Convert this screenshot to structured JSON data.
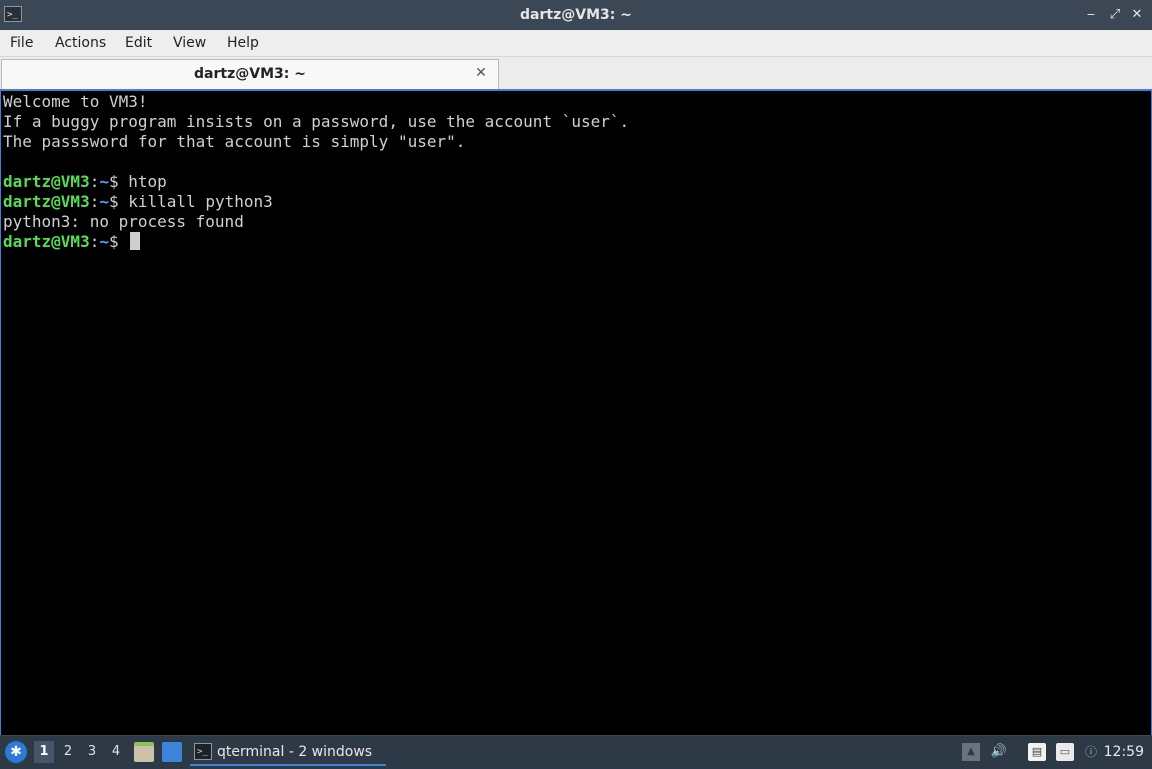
{
  "window": {
    "title": "dartz@VM3: ~",
    "app_icon": "terminal-icon",
    "buttons": {
      "minimize": "‒",
      "restore": "⤢",
      "close": "✕"
    }
  },
  "menubar": {
    "items": [
      "File",
      "Actions",
      "Edit",
      "View",
      "Help"
    ]
  },
  "tabs": [
    {
      "label": "dartz@VM3: ~",
      "close": "✕"
    }
  ],
  "terminal": {
    "motd": [
      "Welcome to VM3!",
      "If a buggy program insists on a password, use the account `user`.",
      "The passsword for that account is simply \"user\"."
    ],
    "prompt_user": "dartz@VM3",
    "prompt_colon": ":",
    "prompt_path": "~",
    "prompt_symbol": "$ ",
    "commands": [
      {
        "cmd": "htop"
      },
      {
        "cmd": "killall python3"
      }
    ],
    "output": "python3: no process found",
    "colors": {
      "background": "#000000",
      "text": "#d0d0d0",
      "user": "#55dd55",
      "path": "#5aa0ff"
    }
  },
  "taskbar": {
    "start_icon": "lxqt-menu-icon",
    "desktops": [
      "1",
      "2",
      "3",
      "4"
    ],
    "active_desktop": "1",
    "quicklaunch": [
      "file-manager-icon",
      "show-desktop-icon"
    ],
    "task": {
      "label": "qterminal - 2 windows",
      "icon": "terminal-icon"
    },
    "tray": [
      "tray-expand-icon",
      "volume-icon",
      "clipboard-icon",
      "network-icon",
      "notification-icon"
    ],
    "clock": "12:59",
    "accent": "#3c82d9"
  }
}
